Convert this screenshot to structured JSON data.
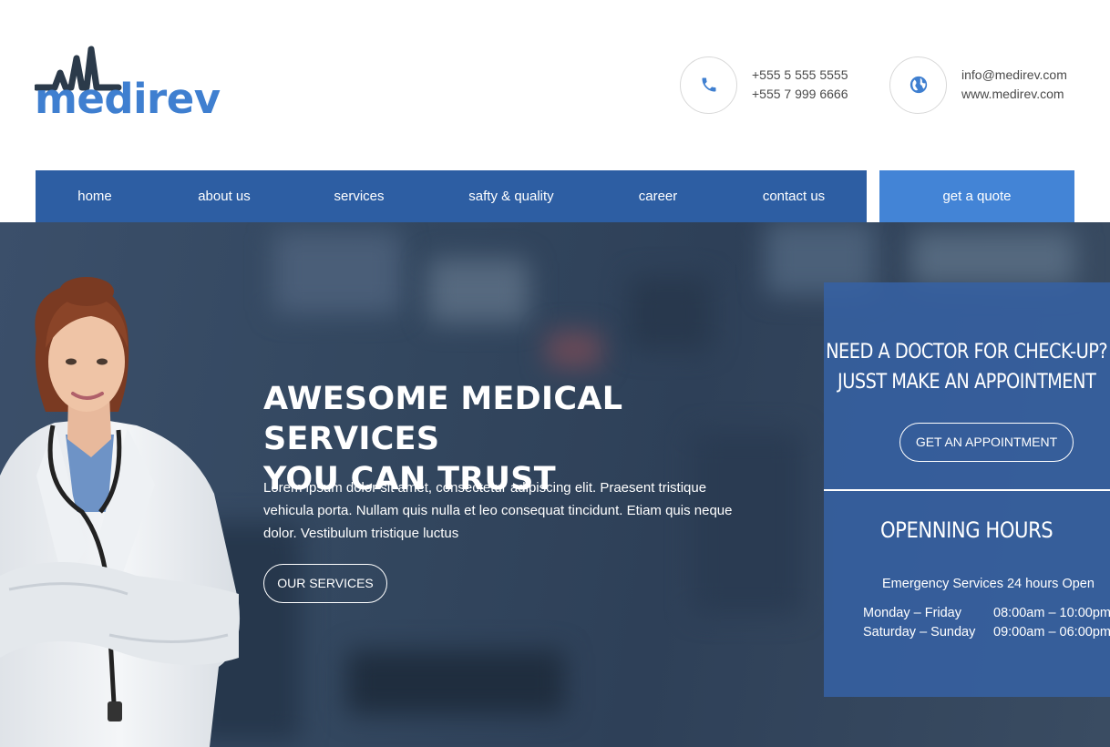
{
  "brand": {
    "name": "medirev",
    "colors": {
      "primary": "#2d5ea3",
      "accent": "#4384d6",
      "logo": "#3f7fd0",
      "logo_mark": "#2b3a4a"
    }
  },
  "contact": {
    "phone_icon": "phone-icon",
    "phones": [
      "+555 5 555 5555",
      "+555 7 999 6666"
    ],
    "web_icon": "globe-icon",
    "email": "info@medirev.com",
    "website": "www.medirev.com"
  },
  "nav": {
    "items": [
      "home",
      "about us",
      "services",
      "safty & quality",
      "career",
      "contact us"
    ],
    "quote": "get a quote"
  },
  "hero": {
    "title_line1": "AWESOME MEDICAL SERVICES",
    "title_line2": "YOU CAN TRUST",
    "text": "Lorem ipsum dolor sit amet, consectetur adipiscing elit. Praesent tristique vehicula porta. Nullam quis nulla et leo consequat tincidunt. Etiam quis neque dolor. Vestibulum tristique luctus",
    "button": "OUR SERVICES"
  },
  "appointment": {
    "heading_line1": "NEED A DOCTOR FOR CHECK-UP?",
    "heading_line2": "JUSST MAKE AN APPOINTMENT",
    "button": "GET AN APPOINTMENT",
    "hours_title": "OPENNING HOURS",
    "emergency": "Emergency Services 24 hours Open",
    "hours": [
      {
        "days": "Monday – Friday",
        "time": "08:00am – 10:00pm"
      },
      {
        "days": "Saturday – Sunday",
        "time": "09:00am – 06:00pm"
      }
    ]
  }
}
